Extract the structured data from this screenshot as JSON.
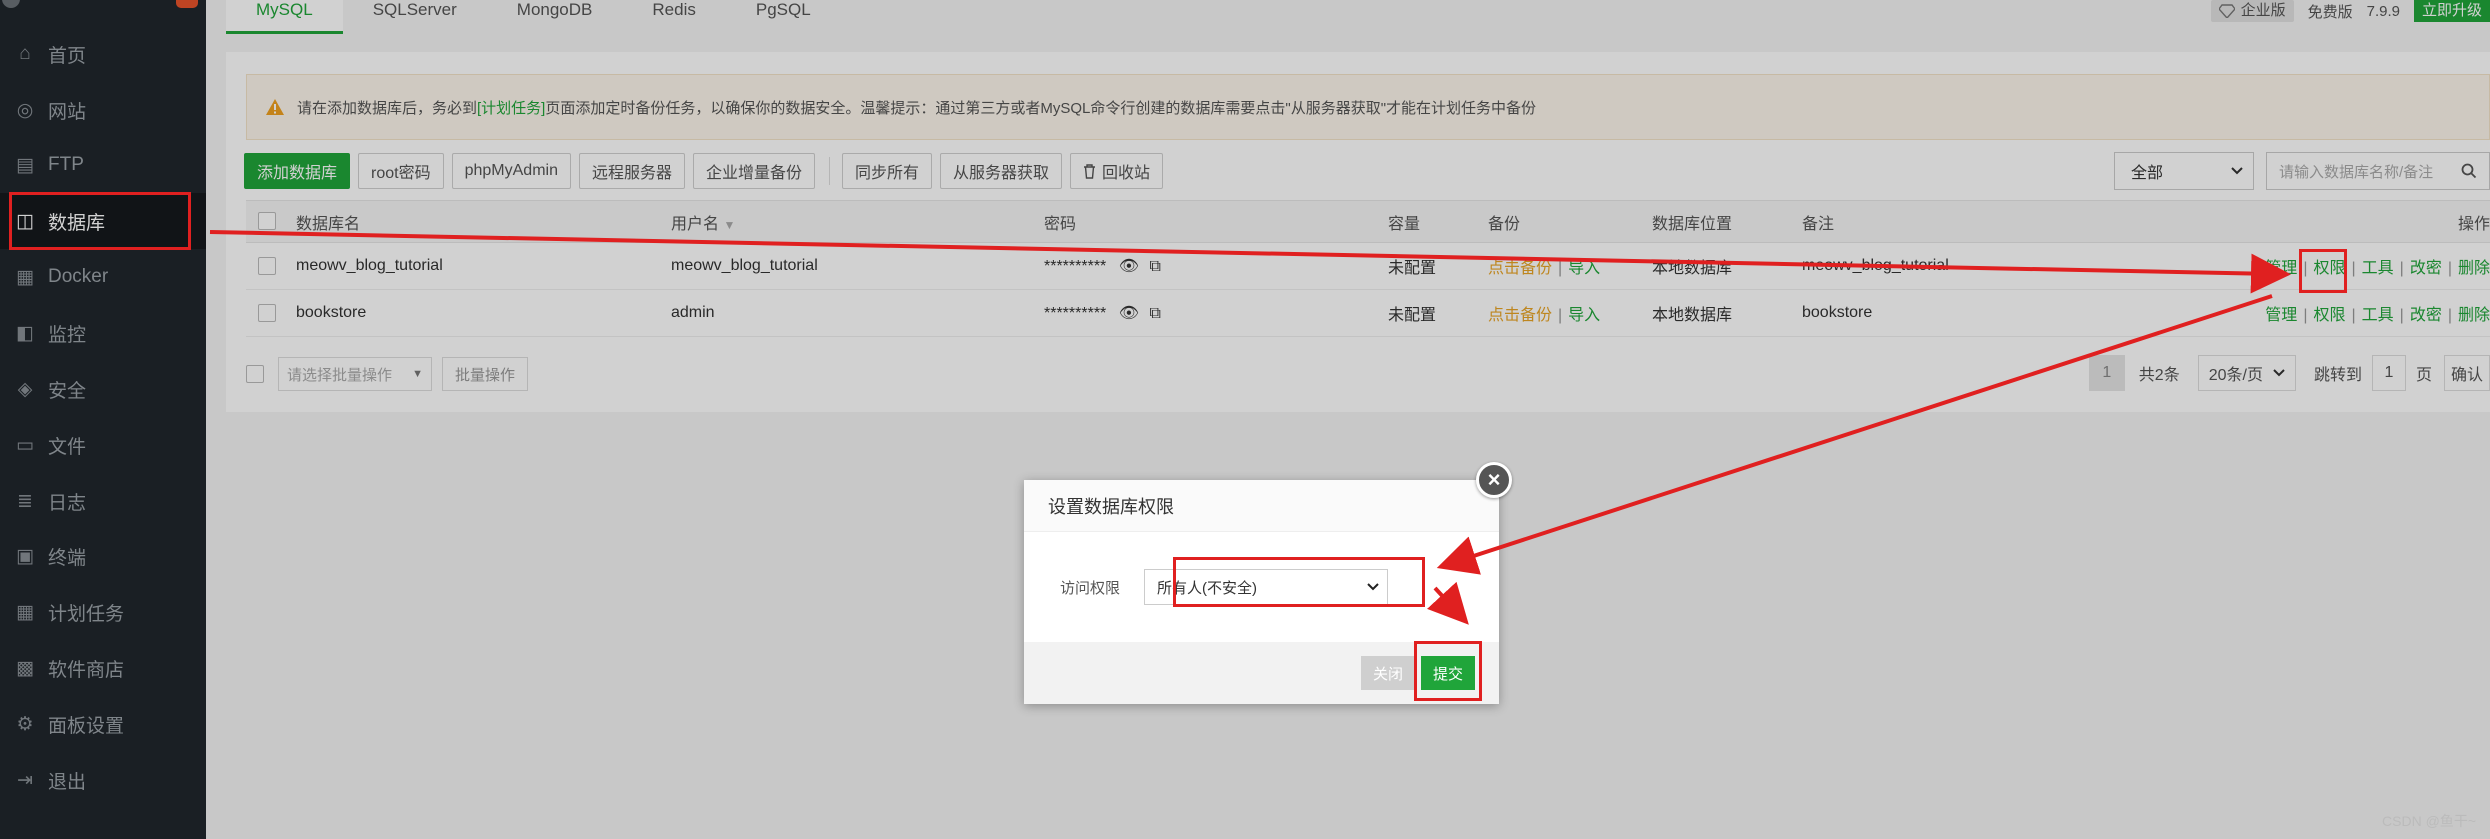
{
  "sidebar": {
    "items": [
      {
        "label": "首页",
        "icon": "home-icon"
      },
      {
        "label": "网站",
        "icon": "globe-icon"
      },
      {
        "label": "FTP",
        "icon": "ftp-icon"
      },
      {
        "label": "数据库",
        "icon": "database-icon",
        "active": true
      },
      {
        "label": "Docker",
        "icon": "docker-icon"
      },
      {
        "label": "监控",
        "icon": "monitor-icon"
      },
      {
        "label": "安全",
        "icon": "shield-icon"
      },
      {
        "label": "文件",
        "icon": "folder-icon"
      },
      {
        "label": "日志",
        "icon": "log-icon"
      },
      {
        "label": "终端",
        "icon": "terminal-icon"
      },
      {
        "label": "计划任务",
        "icon": "calendar-icon"
      },
      {
        "label": "软件商店",
        "icon": "store-icon"
      },
      {
        "label": "面板设置",
        "icon": "gear-icon"
      },
      {
        "label": "退出",
        "icon": "logout-icon"
      }
    ]
  },
  "tabs": [
    "MySQL",
    "SQLServer",
    "MongoDB",
    "Redis",
    "PgSQL"
  ],
  "topbar": {
    "enterprise": "企业版",
    "free": "免费版",
    "version": "7.9.9",
    "upgrade": "立即升级"
  },
  "notice": {
    "part1": "请在添加数据库后，务必到",
    "link": "[计划任务]",
    "part2": "页面添加定时备份任务，以确保你的数据安全。温馨提示：通过第三方或者MySQL命令行创建的数据库需要点击\"从服务器获取\"才能在计划任务中备份"
  },
  "toolbar": {
    "add_db": "添加数据库",
    "root_pwd": "root密码",
    "phpmyadmin": "phpMyAdmin",
    "remote": "远程服务器",
    "incremental": "企业增量备份",
    "sync_all": "同步所有",
    "fetch": "从服务器获取",
    "recycle": "回收站"
  },
  "filter": {
    "selected": "全部"
  },
  "search": {
    "placeholder": "请输入数据库名称/备注"
  },
  "table": {
    "headers": {
      "name": "数据库名",
      "user": "用户名",
      "password": "密码",
      "capacity": "容量",
      "backup": "备份",
      "location": "数据库位置",
      "remark": "备注",
      "ops": "操作"
    },
    "rows": [
      {
        "name": "meowv_blog_tutorial",
        "user": "meowv_blog_tutorial",
        "password": "**********",
        "capacity": "未配置",
        "backup": "点击备份",
        "import": "导入",
        "location": "本地数据库",
        "remark": "meowv_blog_tutorial"
      },
      {
        "name": "bookstore",
        "user": "admin",
        "password": "**********",
        "capacity": "未配置",
        "backup": "点击备份",
        "import": "导入",
        "location": "本地数据库",
        "remark": "bookstore"
      }
    ],
    "ops": [
      "管理",
      "权限",
      "工具",
      "改密",
      "删除"
    ]
  },
  "batch": {
    "placeholder": "请选择批量操作",
    "button": "批量操作"
  },
  "pager": {
    "current": "1",
    "total": "共2条",
    "per_page": "20条/页",
    "goto": "跳转到",
    "goto_value": "1",
    "page_unit": "页",
    "confirm": "确认"
  },
  "dialog": {
    "title": "设置数据库权限",
    "label": "访问权限",
    "value": "所有人(不安全)",
    "close": "关闭",
    "submit": "提交"
  },
  "watermark": "CSDN @鱼干~"
}
